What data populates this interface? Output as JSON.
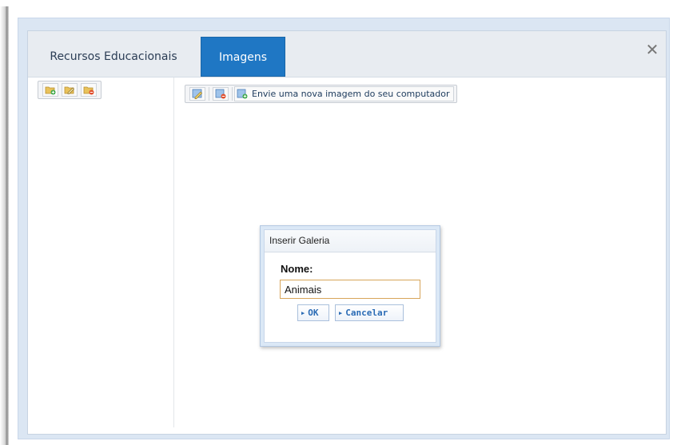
{
  "tabs": [
    {
      "label": "Recursos Educacionais",
      "active": false
    },
    {
      "label": "Imagens",
      "active": true
    }
  ],
  "close_icon": "close-icon",
  "sidebar": {
    "toolbar": [
      {
        "icon": "folder-add-icon"
      },
      {
        "icon": "folder-edit-icon"
      },
      {
        "icon": "folder-delete-icon"
      }
    ]
  },
  "main": {
    "toolbar": {
      "edit_icon": "image-edit-icon",
      "delete_icon": "image-delete-icon",
      "upload_icon": "image-upload-icon",
      "upload_label": "Envie uma nova imagem do seu computador"
    }
  },
  "dialog": {
    "title": "Inserir Galeria",
    "field_label": "Nome:",
    "field_value": "Animais",
    "ok_label": "OK",
    "cancel_label": "Cancelar"
  },
  "colors": {
    "active_tab": "#1f77c4",
    "button_text": "#2a6bb5",
    "input_border": "#d7a55a"
  }
}
